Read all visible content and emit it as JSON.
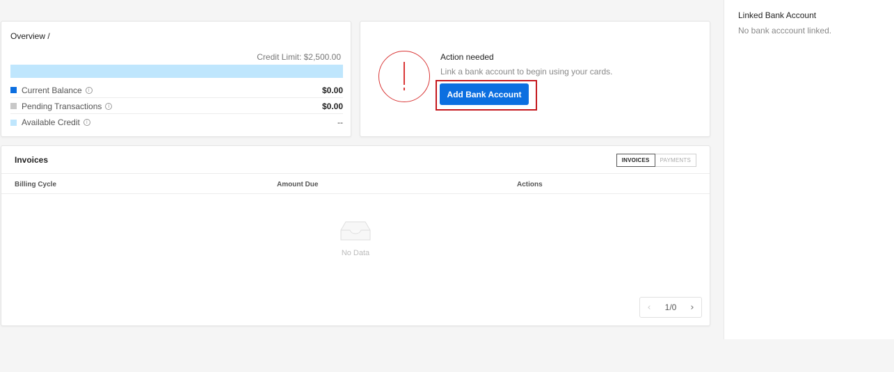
{
  "overview": {
    "title": "Overview /",
    "credit_limit": "Credit Limit: $2,500.00",
    "rows": [
      {
        "label": "Current Balance",
        "value": "$0.00",
        "color": "#0c6fe0"
      },
      {
        "label": "Pending Transactions",
        "value": "$0.00",
        "color": "#c8c8c8"
      },
      {
        "label": "Available Credit",
        "value": "--",
        "color": "#bfe6fd"
      }
    ]
  },
  "action": {
    "title": "Action needed",
    "text": "Link a bank account to begin using your cards.",
    "button_label": "Add Bank Account",
    "alert_color": "#d93636"
  },
  "invoices": {
    "title": "Invoices",
    "tabs": [
      {
        "label": "INVOICES",
        "active": true
      },
      {
        "label": "PAYMENTS",
        "active": false
      }
    ],
    "columns": [
      "Billing Cycle",
      "Amount Due",
      "Actions"
    ],
    "empty_text": "No Data",
    "pagination": "1/0"
  },
  "linked_bank": {
    "title": "Linked Bank Account",
    "text": "No bank acccount linked."
  },
  "colors": {
    "primary": "#0c6fe0",
    "highlight_border": "#c4161c"
  }
}
